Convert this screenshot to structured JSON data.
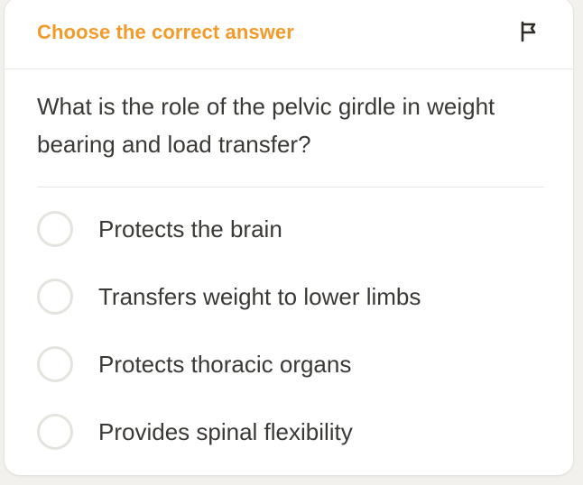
{
  "header": {
    "title": "Choose the correct answer",
    "flag_icon": "flag-icon",
    "accent_color": "#f49a2a"
  },
  "question": {
    "text": "What is the role of the pelvic girdle in weight bearing and load transfer?"
  },
  "options": [
    {
      "label": "Protects the brain"
    },
    {
      "label": "Transfers weight to lower limbs"
    },
    {
      "label": "Protects thoracic organs"
    },
    {
      "label": "Provides spinal flexibility"
    }
  ]
}
